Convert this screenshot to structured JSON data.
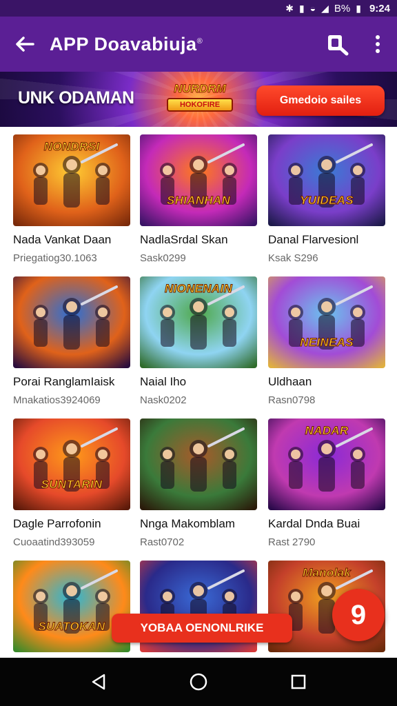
{
  "status_bar": {
    "battery": "B%",
    "time": "9:24"
  },
  "app_bar": {
    "title": "APP Doavabiuja",
    "title_mark": "®"
  },
  "banner": {
    "title": "UNK ODAMAN",
    "logo_top": "NURDRM",
    "logo_bottom": "HOKOFIRE",
    "cta_label": "Gmedoio sailes"
  },
  "games": [
    {
      "title": "Nada Vankat Daan",
      "subtitle": "Priegatiog30.1063",
      "caption": "NONDRSI"
    },
    {
      "title": "NadlaSrdal Skan",
      "subtitle": "Sask0299",
      "caption": "SHIANHAN"
    },
    {
      "title": "Danal Flarvesionl",
      "subtitle": "Ksak S296",
      "caption": "YUIDEAS"
    },
    {
      "title": "Porai RanglamIaisk",
      "subtitle": "Mnakatios3924069",
      "caption": ""
    },
    {
      "title": "Naial Iho",
      "subtitle": "Nask0202",
      "caption": "NIONENAIN"
    },
    {
      "title": "Uldhaan",
      "subtitle": "Rasn0798",
      "caption": "NEINEAS"
    },
    {
      "title": "Dagle Parrofonin",
      "subtitle": "Cuoaatind393059",
      "caption": "SUNTARIN"
    },
    {
      "title": "Nnga Makomblam",
      "subtitle": "Rast0702",
      "caption": ""
    },
    {
      "title": "Kardal Dnda Buai",
      "subtitle": "Rast 2790",
      "caption": "NADAR"
    },
    {
      "title": "",
      "subtitle": "",
      "caption": "SUATOKAN"
    },
    {
      "title": "",
      "subtitle": "",
      "caption": ""
    },
    {
      "title": "",
      "subtitle": "",
      "caption": "Manolak"
    }
  ],
  "snackbar": {
    "label": "YOBAA OENONLRIKE"
  },
  "fab": {
    "label": "9"
  },
  "colors": {
    "app_bar": "#5b1f95",
    "status_bar": "#3a1466",
    "accent_red": "#e8301d",
    "nav_bar": "#050505"
  }
}
